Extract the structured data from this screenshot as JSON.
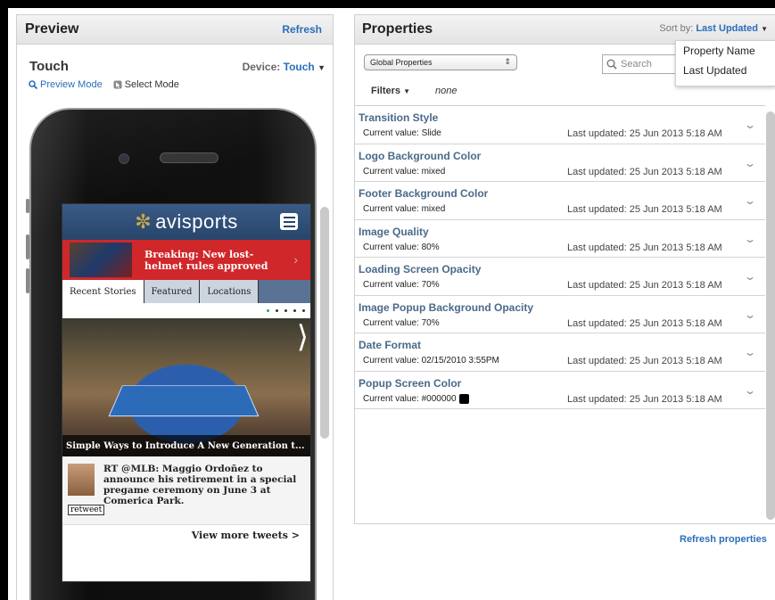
{
  "preview": {
    "title": "Preview",
    "refresh_label": "Refresh",
    "touch_title": "Touch",
    "device_label": "Device:",
    "device_value": "Touch",
    "preview_mode_label": "Preview Mode",
    "select_mode_label": "Select Mode",
    "site": {
      "logo": "avisports",
      "breaking": "Breaking: New lost-helmet rules approved",
      "tabs": [
        "Recent Stories",
        "Featured",
        "Locations"
      ],
      "hero_caption": "Simple Ways to Introduce A New Generation t...",
      "tweet": "RT @MLB: Maggio Ordoñez to announce his retirement in a special pregame ceremony on June 3 at Comerica Park.",
      "retweet_label": "retweet",
      "view_more": "View more tweets >"
    }
  },
  "properties": {
    "title": "Properties",
    "sort_label": "Sort by:",
    "sort_value": "Last Updated",
    "sort_options": [
      "Property Name",
      "Last Updated"
    ],
    "scope_select": "Global Properties",
    "search_placeholder": "Search",
    "filters_label": "Filters",
    "filters_value": "none",
    "items": [
      {
        "name": "Transition Style",
        "value": "Current value: Slide",
        "updated": "Last updated: 25 Jun 2013 5:18 AM"
      },
      {
        "name": "Logo Background Color",
        "value": "Current value: mixed",
        "updated": "Last updated: 25 Jun 2013 5:18 AM"
      },
      {
        "name": "Footer Background Color",
        "value": "Current value: mixed",
        "updated": "Last updated: 25 Jun 2013 5:18 AM"
      },
      {
        "name": "Image Quality",
        "value": "Current value: 80%",
        "updated": "Last updated: 25 Jun 2013 5:18 AM"
      },
      {
        "name": "Loading Screen Opacity",
        "value": "Current value: 70%",
        "updated": "Last updated: 25 Jun 2013 5:18 AM"
      },
      {
        "name": "Image Popup Background Opacity",
        "value": "Current value: 70%",
        "updated": "Last updated: 25 Jun 2013 5:18 AM"
      },
      {
        "name": "Date Format",
        "value": "Current value: 02/15/2010 3:55PM",
        "updated": "Last updated: 25 Jun 2013 5:18 AM"
      },
      {
        "name": "Popup Screen Color",
        "value": "Current value: #000000",
        "updated": "Last updated: 25 Jun 2013 5:18 AM",
        "swatch": "#000000"
      }
    ],
    "refresh_label": "Refresh properties"
  },
  "colors": {
    "accent": "#2a6ebb",
    "breaking_red": "#d0272a",
    "site_header": "#27456b"
  }
}
